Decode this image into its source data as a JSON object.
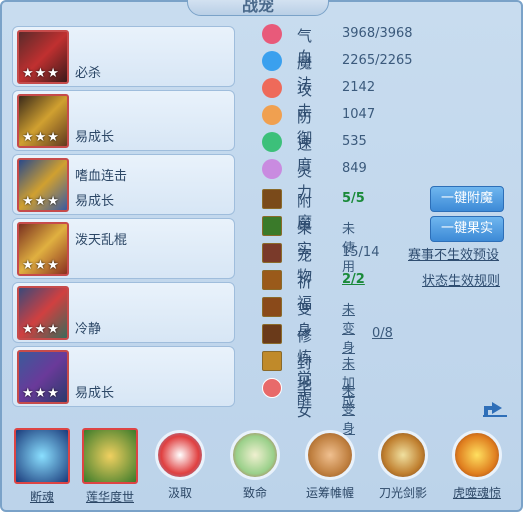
{
  "title": "战宠",
  "skills": [
    {
      "name": "必杀",
      "stars": "★★★"
    },
    {
      "name": "易成长",
      "stars": "★★★"
    },
    {
      "name": "嗜血连击",
      "name2": "易成长",
      "stars": "★★★"
    },
    {
      "name": "泼天乱棍",
      "stars": "★★★"
    },
    {
      "name": "冷静",
      "stars": "★★★"
    },
    {
      "name": "易成长",
      "stars": "★★★"
    }
  ],
  "stats": [
    {
      "label": "气血",
      "value": "3968/3968",
      "icon": "heart-gem-icon",
      "color": "#e85a7a"
    },
    {
      "label": "魔法",
      "value": "2265/2265",
      "icon": "blue-gem-icon",
      "color": "#3aa0ee"
    },
    {
      "label": "攻击",
      "value": "2142",
      "icon": "red-gem-icon",
      "color": "#ee6a5a"
    },
    {
      "label": "防御",
      "value": "1047",
      "icon": "orange-gem-icon",
      "color": "#f0a050"
    },
    {
      "label": "速度",
      "value": "535",
      "icon": "green-gem-icon",
      "color": "#3cc07a"
    },
    {
      "label": "灵力",
      "value": "849",
      "icon": "purple-gem-icon",
      "color": "#c98be0"
    }
  ],
  "extras": [
    {
      "label": "附魔",
      "value": "5/5",
      "icon": "enchant-icon"
    },
    {
      "label": "果实",
      "value": "未使用",
      "icon": "fruit-icon"
    },
    {
      "label": "宠物",
      "value": "15/14",
      "icon": "pet-icon"
    },
    {
      "label": "祈福",
      "value": "2/2",
      "icon": "bless-icon"
    },
    {
      "label": "变身",
      "value": "未变身",
      "icon": "transform-icon"
    },
    {
      "label": "修炼觉醒",
      "value": "0/8",
      "icon": "cultivate-icon"
    },
    {
      "label": "封地",
      "value": "未加成",
      "icon": "fief-icon"
    },
    {
      "label": "子女",
      "value": "未变身",
      "icon": "child-icon"
    }
  ],
  "buttons": {
    "enchant": "一键附魔",
    "fruit": "一键果实"
  },
  "links": {
    "preset": "赛事不生效预设",
    "rule": "状态生效规则"
  },
  "bottom_skills": [
    "断魂",
    "莲华度世",
    "汲取",
    "致命",
    "运筹帷幄",
    "刀光剑影",
    "虎噬魂惊"
  ]
}
